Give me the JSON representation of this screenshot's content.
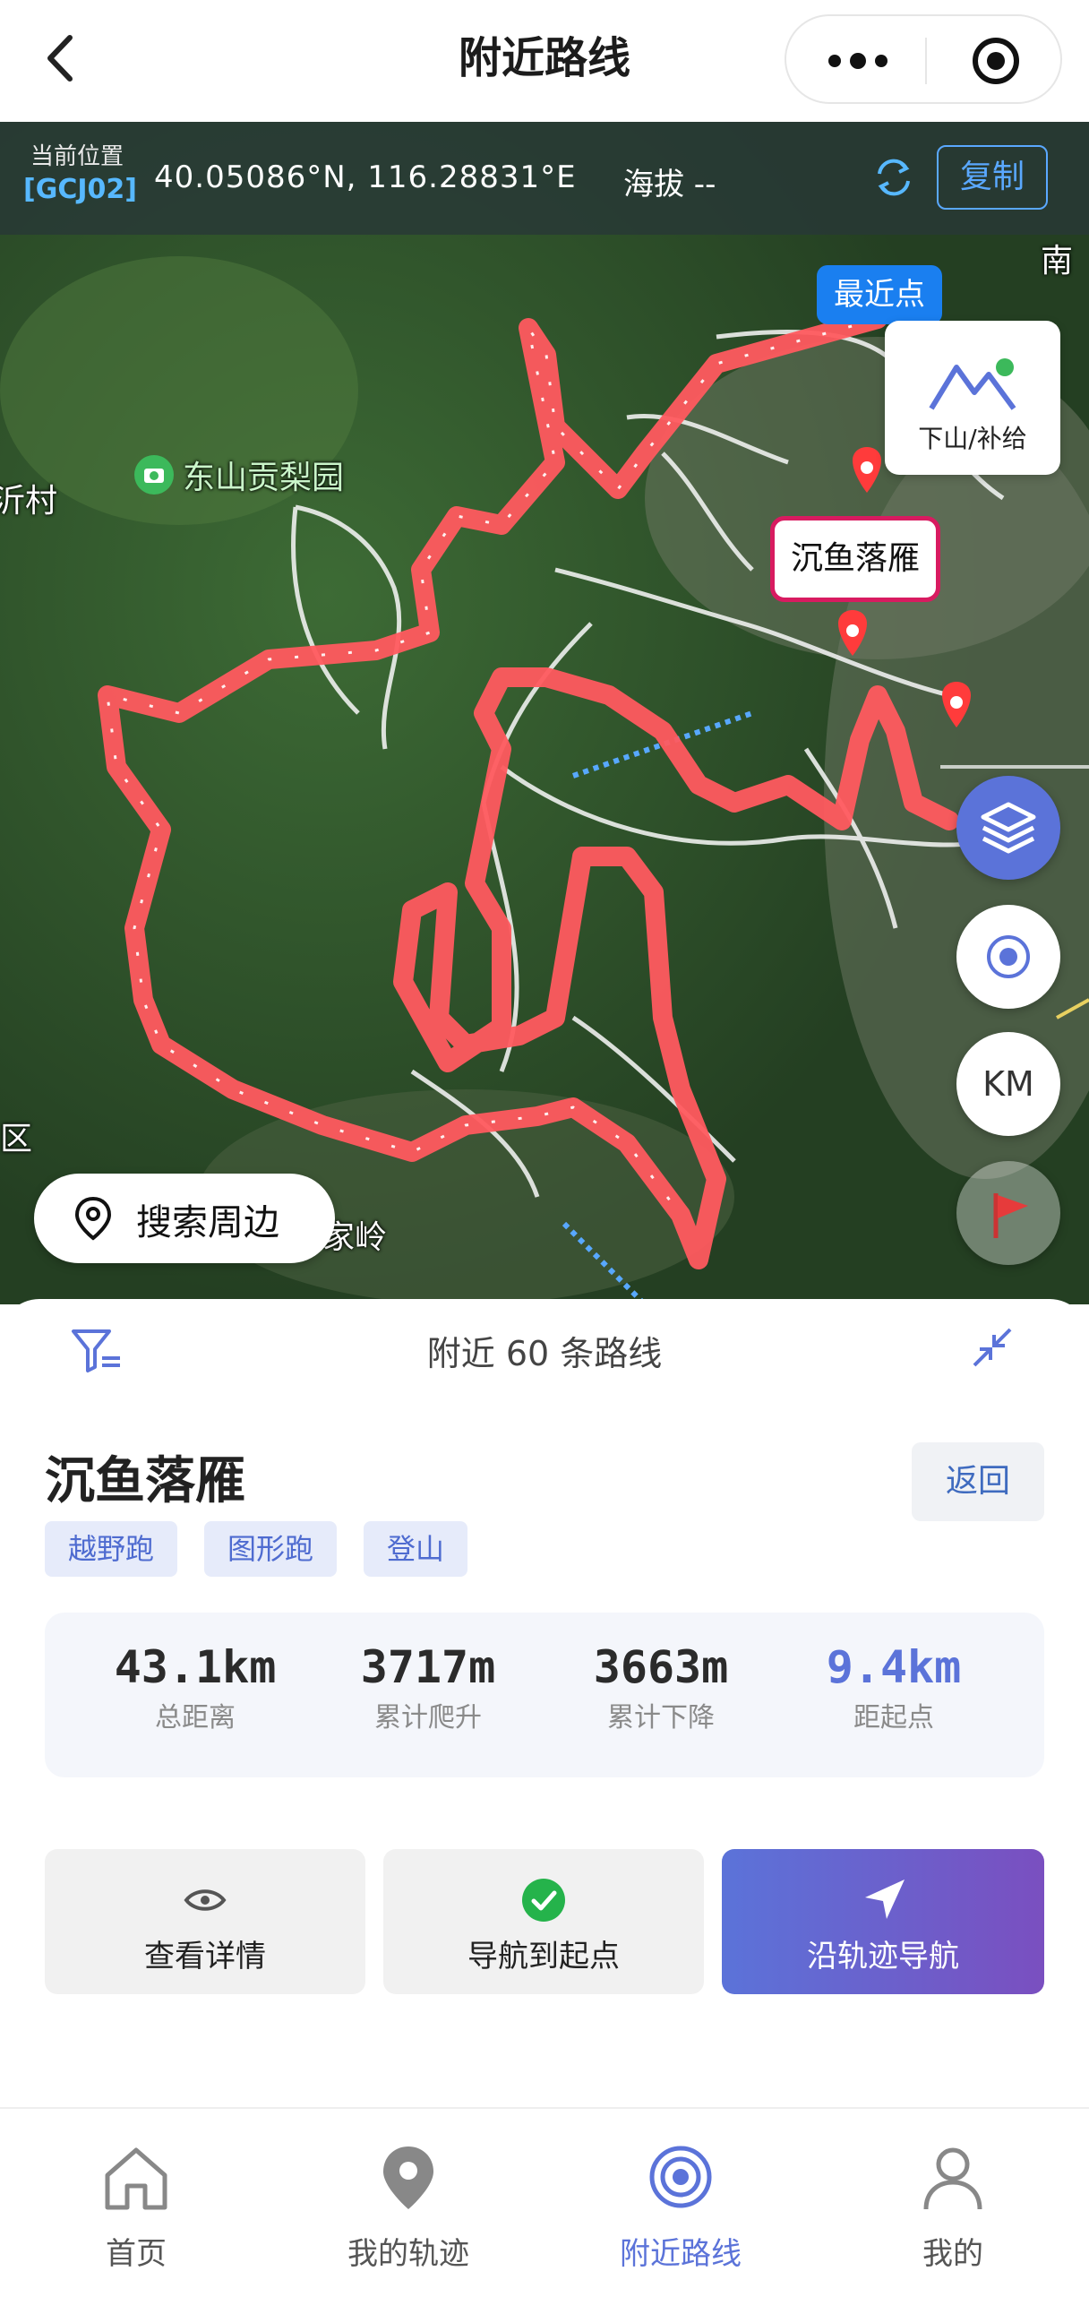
{
  "header": {
    "title": "附近路线"
  },
  "location": {
    "label": "当前位置",
    "coord_system": "[GCJ02]",
    "coords": "40.05086°N, 116.28831°E",
    "altitude": "海拔 --",
    "copy_label": "复制"
  },
  "map": {
    "labels": {
      "poi": "东山贡梨园",
      "village_left": "沂村",
      "district_left": "区",
      "place_bottom": "家岭",
      "top_right": "南"
    },
    "nearest_tag": "最近点",
    "supply_label": "下山/补给",
    "route_callout": "沉鱼落雁",
    "scale_button": "KM",
    "search_label": "搜索周边",
    "route_color": "#ff5a5f"
  },
  "panel": {
    "nearby_count": "附近 60 条路线",
    "route_name": "沉鱼落雁",
    "back_label": "返回",
    "tags": [
      "越野跑",
      "图形跑",
      "登山"
    ],
    "stats": [
      {
        "value": "43.1km",
        "label": "总距离"
      },
      {
        "value": "3717m",
        "label": "累计爬升"
      },
      {
        "value": "3663m",
        "label": "累计下降"
      },
      {
        "value": "9.4km",
        "label": "距起点",
        "highlight": true
      }
    ],
    "actions": {
      "details": "查看详情",
      "nav_start": "导航到起点",
      "follow_track": "沿轨迹导航"
    },
    "accent_color": "#5b73d9"
  },
  "bottom_nav": [
    {
      "label": "首页",
      "icon": "home-icon"
    },
    {
      "label": "我的轨迹",
      "icon": "location-pin-icon"
    },
    {
      "label": "附近路线",
      "icon": "target-icon",
      "active": true
    },
    {
      "label": "我的",
      "icon": "user-icon"
    }
  ]
}
